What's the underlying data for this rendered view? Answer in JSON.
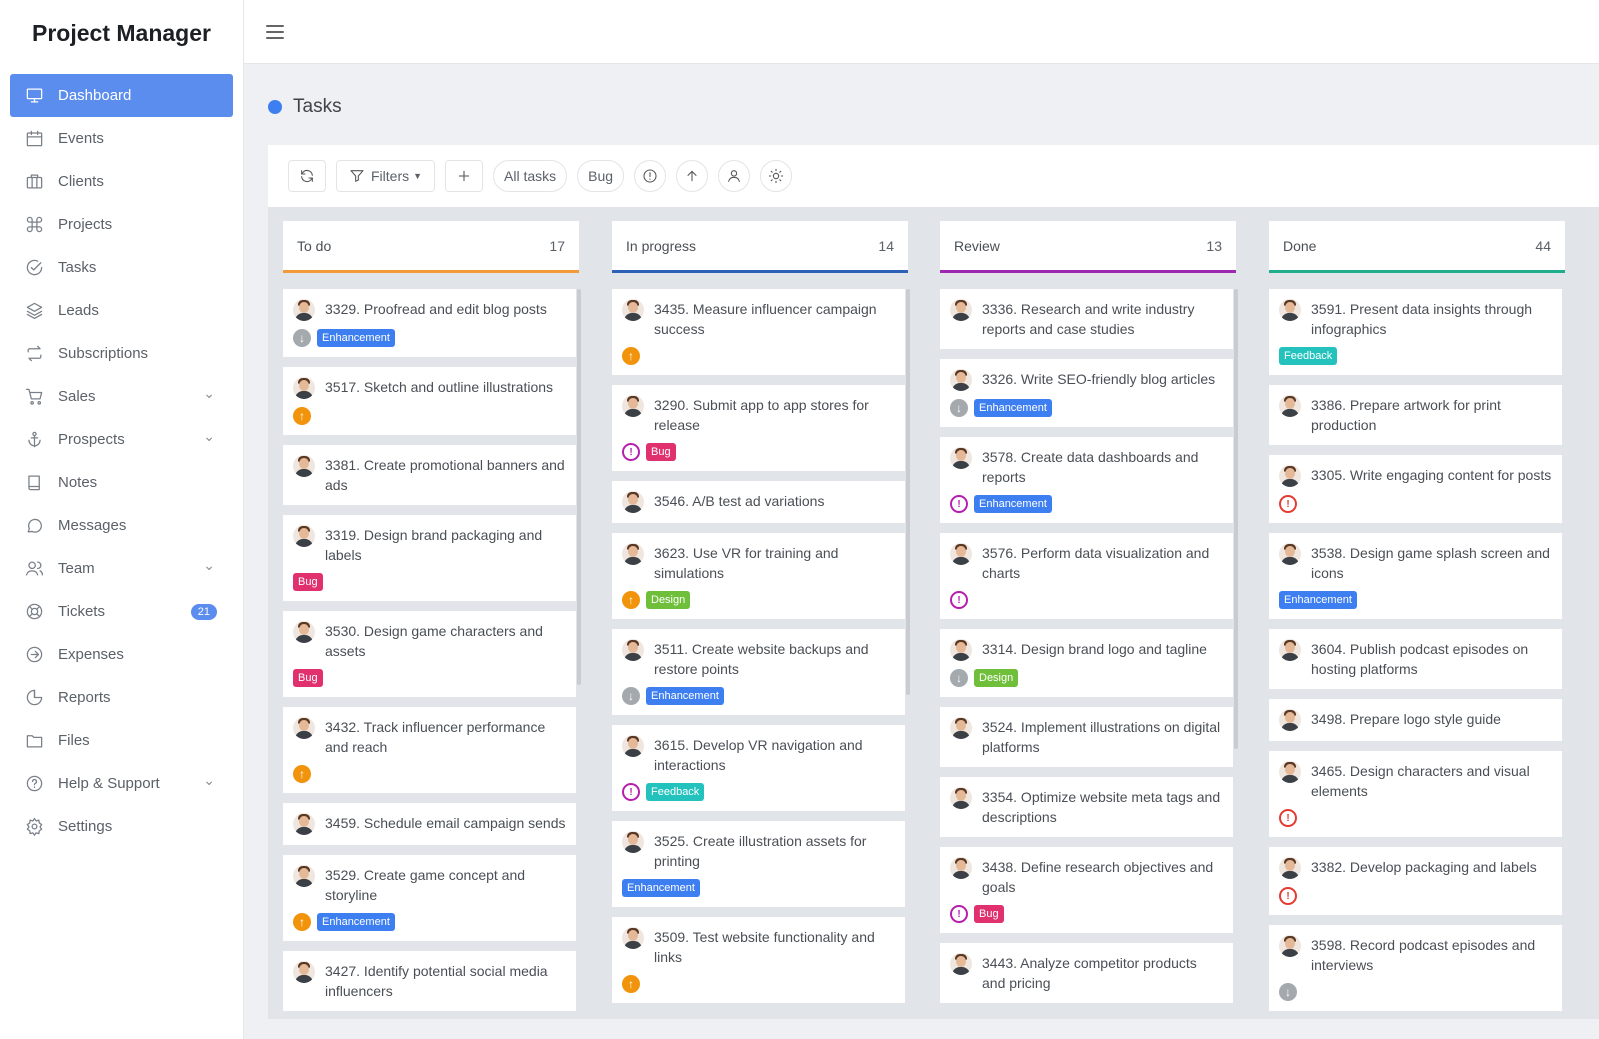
{
  "app": {
    "title": "Project Manager"
  },
  "sidebar": {
    "items": [
      {
        "label": "Dashboard",
        "icon": "monitor-icon",
        "active": true
      },
      {
        "label": "Events",
        "icon": "calendar-icon"
      },
      {
        "label": "Clients",
        "icon": "briefcase-icon"
      },
      {
        "label": "Projects",
        "icon": "command-icon"
      },
      {
        "label": "Tasks",
        "icon": "check-circle-icon"
      },
      {
        "label": "Leads",
        "icon": "layers-icon"
      },
      {
        "label": "Subscriptions",
        "icon": "repeat-icon"
      },
      {
        "label": "Sales",
        "icon": "cart-icon",
        "has_submenu": true
      },
      {
        "label": "Prospects",
        "icon": "anchor-icon",
        "has_submenu": true
      },
      {
        "label": "Notes",
        "icon": "book-icon"
      },
      {
        "label": "Messages",
        "icon": "message-icon"
      },
      {
        "label": "Team",
        "icon": "users-icon",
        "has_submenu": true
      },
      {
        "label": "Tickets",
        "icon": "lifebuoy-icon",
        "badge": "21"
      },
      {
        "label": "Expenses",
        "icon": "arrow-circle-icon"
      },
      {
        "label": "Reports",
        "icon": "pie-chart-icon"
      },
      {
        "label": "Files",
        "icon": "folder-icon"
      },
      {
        "label": "Help & Support",
        "icon": "help-circle-icon",
        "has_submenu": true
      },
      {
        "label": "Settings",
        "icon": "gear-icon"
      }
    ]
  },
  "page": {
    "title": "Tasks",
    "accent": "#3d7ef0"
  },
  "toolbar": {
    "filters_label": "Filters",
    "all_tasks_label": "All tasks",
    "bug_label": "Bug"
  },
  "columns": [
    {
      "title": "To do",
      "count": "17",
      "color": "#f19a36",
      "cards": [
        {
          "title": "3329. Proofread and edit blog posts",
          "priority": "low",
          "tag": "Enhancement"
        },
        {
          "title": "3517. Sketch and outline illustrations",
          "priority": "high",
          "tag": ""
        },
        {
          "title": "3381. Create promotional banners and ads",
          "priority": "",
          "tag": ""
        },
        {
          "title": "3319. Design brand packaging and labels",
          "priority": "",
          "tag": "Bug"
        },
        {
          "title": "3530. Design game characters and assets",
          "priority": "",
          "tag": "Bug"
        },
        {
          "title": "3432. Track influencer performance and reach",
          "priority": "high",
          "tag": ""
        },
        {
          "title": "3459. Schedule email campaign sends",
          "priority": "",
          "tag": ""
        },
        {
          "title": "3529. Create game concept and storyline",
          "priority": "high",
          "tag": "Enhancement"
        },
        {
          "title": "3427. Identify potential social media influencers",
          "priority": "",
          "tag": ""
        }
      ]
    },
    {
      "title": "In progress",
      "count": "14",
      "color": "#2b62b8",
      "cards": [
        {
          "title": "3435. Measure influencer campaign success",
          "priority": "high",
          "tag": ""
        },
        {
          "title": "3290. Submit app to app stores for release",
          "priority": "crit",
          "tag": "Bug"
        },
        {
          "title": "3546. A/B test ad variations",
          "priority": "",
          "tag": ""
        },
        {
          "title": "3623. Use VR for training and simulations",
          "priority": "high",
          "tag": "Design"
        },
        {
          "title": "3511. Create website backups and restore points",
          "priority": "low",
          "tag": "Enhancement"
        },
        {
          "title": "3615. Develop VR navigation and interactions",
          "priority": "crit",
          "tag": "Feedback"
        },
        {
          "title": "3525. Create illustration assets for printing",
          "priority": "",
          "tag": "Enhancement"
        },
        {
          "title": "3509. Test website functionality and links",
          "priority": "high",
          "tag": ""
        }
      ]
    },
    {
      "title": "Review",
      "count": "13",
      "color": "#9c27b0",
      "cards": [
        {
          "title": "3336. Research and write industry reports and case studies",
          "priority": "",
          "tag": ""
        },
        {
          "title": "3326. Write SEO-friendly blog articles",
          "priority": "low",
          "tag": "Enhancement"
        },
        {
          "title": "3578. Create data dashboards and reports",
          "priority": "crit",
          "tag": "Enhancement"
        },
        {
          "title": "3576. Perform data visualization and charts",
          "priority": "crit",
          "tag": ""
        },
        {
          "title": "3314. Design brand logo and tagline",
          "priority": "low",
          "tag": "Design"
        },
        {
          "title": "3524. Implement illustrations on digital platforms",
          "priority": "",
          "tag": ""
        },
        {
          "title": "3354. Optimize website meta tags and descriptions",
          "priority": "",
          "tag": ""
        },
        {
          "title": "3438. Define research objectives and goals",
          "priority": "crit",
          "tag": "Bug"
        },
        {
          "title": "3443. Analyze competitor products and pricing",
          "priority": "",
          "tag": ""
        }
      ]
    },
    {
      "title": "Done",
      "count": "44",
      "color": "#1fae8c",
      "cards": [
        {
          "title": "3591. Present data insights through infographics",
          "priority": "",
          "tag": "Feedback"
        },
        {
          "title": "3386. Prepare artwork for print production",
          "priority": "",
          "tag": ""
        },
        {
          "title": "3305. Write engaging content for posts",
          "priority": "urgent",
          "tag": ""
        },
        {
          "title": "3538. Design game splash screen and icons",
          "priority": "",
          "tag": "Enhancement"
        },
        {
          "title": "3604. Publish podcast episodes on hosting platforms",
          "priority": "",
          "tag": ""
        },
        {
          "title": "3498. Prepare logo style guide",
          "priority": "",
          "tag": ""
        },
        {
          "title": "3465. Design characters and visual elements",
          "priority": "urgent",
          "tag": ""
        },
        {
          "title": "3382. Develop packaging and labels",
          "priority": "urgent",
          "tag": ""
        },
        {
          "title": "3598. Record podcast episodes and interviews",
          "priority": "low",
          "tag": ""
        }
      ]
    }
  ]
}
